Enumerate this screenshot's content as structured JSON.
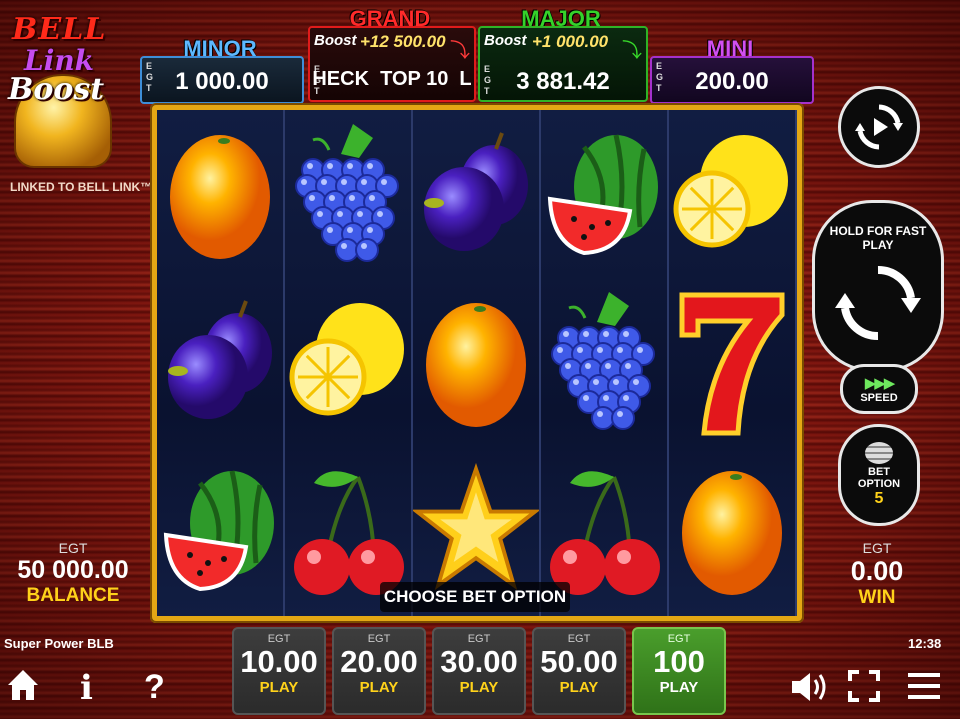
{
  "logo": {
    "line1": "BELL",
    "line2": "Link",
    "line3": "Boost",
    "tagline": "LINKED TO BELL LINK™"
  },
  "jackpots": {
    "minor": {
      "title": "MINOR",
      "egt": "EGT",
      "value": "1 000.00",
      "color": "#5db8ff"
    },
    "grand": {
      "title": "GRAND",
      "egt": "EGT",
      "boost": "Boost",
      "boost_value": "+12 500.00",
      "value": "HECK  TOP 10  L",
      "color": "#ff2a2a"
    },
    "major": {
      "title": "MAJOR",
      "egt": "EGT",
      "boost": "Boost",
      "boost_value": "+1 000.00",
      "value": "3 881.42",
      "color": "#35d22a"
    },
    "mini": {
      "title": "MINI",
      "egt": "EGT",
      "value": "200.00",
      "color": "#d24ff0"
    }
  },
  "reels": [
    [
      "orange",
      "plum",
      "watermelon"
    ],
    [
      "grapes",
      "lemon",
      "cherry"
    ],
    [
      "plum",
      "orange",
      "star"
    ],
    [
      "watermelon",
      "grapes",
      "cherry"
    ],
    [
      "lemon",
      "seven",
      "orange"
    ]
  ],
  "message": "CHOOSE BET OPTION",
  "balance": {
    "egt": "EGT",
    "amount": "50 000.00",
    "label": "BALANCE"
  },
  "win": {
    "egt": "EGT",
    "amount": "0.00",
    "label": "WIN"
  },
  "game_name": "Super Power BLB",
  "clock": "12:38",
  "controls": {
    "fast_play": "HOLD FOR FAST PLAY",
    "speed": "SPEED",
    "bet_option_line1": "BET",
    "bet_option_line2": "OPTION",
    "bet_option_value": "5"
  },
  "bets": [
    {
      "egt": "EGT",
      "value": "10.00",
      "play": "PLAY"
    },
    {
      "egt": "EGT",
      "value": "20.00",
      "play": "PLAY"
    },
    {
      "egt": "EGT",
      "value": "30.00",
      "play": "PLAY"
    },
    {
      "egt": "EGT",
      "value": "50.00",
      "play": "PLAY"
    },
    {
      "egt": "EGT",
      "value": "100",
      "play": "PLAY",
      "selected": true
    }
  ],
  "bottom_icons": {
    "home": "home-icon",
    "info": "info-icon",
    "help": "help-icon",
    "sound": "speaker-icon",
    "fullscreen": "fullscreen-icon",
    "menu": "hamburger-menu-icon"
  },
  "colors": {
    "accent_gold": "#ffd21a",
    "selected_bet": "#3f8f22",
    "reel_bg": "#0c1430"
  }
}
